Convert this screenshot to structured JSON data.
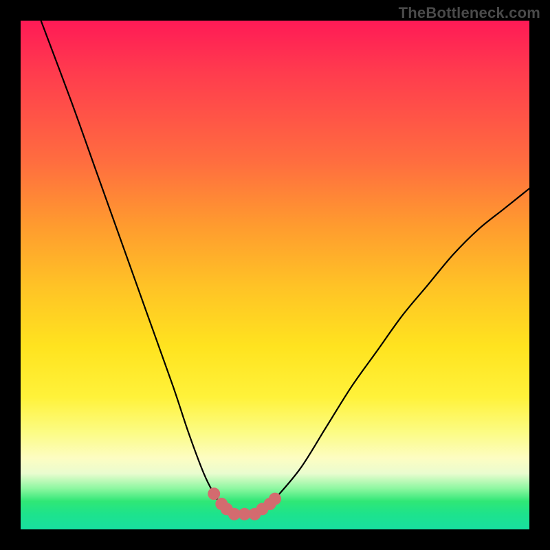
{
  "watermark": "TheBottleneck.com",
  "chart_data": {
    "type": "line",
    "title": "",
    "xlabel": "",
    "ylabel": "",
    "x_range": [
      0,
      100
    ],
    "y_range": [
      0,
      100
    ],
    "series": [
      {
        "name": "bottleneck-curve",
        "x": [
          4,
          10,
          15,
          20,
          25,
          30,
          33,
          36,
          38,
          40,
          42,
          44,
          46,
          48,
          50,
          55,
          60,
          65,
          70,
          75,
          80,
          85,
          90,
          95,
          100
        ],
        "y": [
          100,
          84,
          70,
          56,
          42,
          28,
          19,
          11,
          7,
          4,
          3,
          3,
          3,
          4,
          6,
          12,
          20,
          28,
          35,
          42,
          48,
          54,
          59,
          63,
          67
        ]
      }
    ],
    "markers": {
      "name": "highlight-points",
      "color": "#d36b6f",
      "x": [
        38,
        39.5,
        40.5,
        42,
        44,
        46,
        47.5,
        49,
        50
      ],
      "y": [
        7,
        5,
        4,
        3,
        3,
        3,
        4,
        5,
        6
      ],
      "radius_px": 9
    },
    "gradient_stops": [
      {
        "pos": 0.0,
        "color": "#ff1a56"
      },
      {
        "pos": 0.28,
        "color": "#ff6e3f"
      },
      {
        "pos": 0.52,
        "color": "#ffc226"
      },
      {
        "pos": 0.74,
        "color": "#fff23a"
      },
      {
        "pos": 0.88,
        "color": "#fdfdc2"
      },
      {
        "pos": 0.94,
        "color": "#2fe776"
      },
      {
        "pos": 1.0,
        "color": "#18e0a0"
      }
    ]
  }
}
